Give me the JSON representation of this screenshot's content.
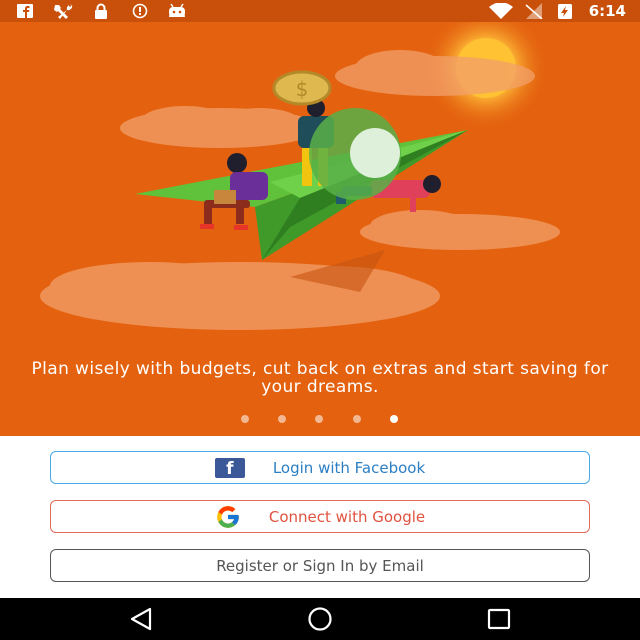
{
  "status_bar": {
    "time": "6:14",
    "icons": [
      "facebook-notif-icon",
      "tools-notif-icon",
      "lock-notif-icon",
      "info-notif-icon",
      "android-notif-icon",
      "wifi-icon",
      "signal-icon",
      "battery-charging-icon"
    ]
  },
  "onboarding": {
    "tagline": "Plan wisely with budgets, cut back on extras and start saving for your dreams.",
    "page_count": 5,
    "active_page": 5
  },
  "actions": {
    "facebook_label": "Login with Facebook",
    "google_label": "Connect with Google",
    "email_label": "Register or Sign In by Email"
  },
  "nav_bar": {
    "icons": [
      "back-icon",
      "home-icon",
      "recents-icon"
    ]
  },
  "colors": {
    "hero_bg": "#e4620f",
    "status_bar": "#c8500a",
    "facebook": "#3b5998",
    "facebook_button_border": "#4aa9e8",
    "google_button_border": "#e56a5a"
  }
}
